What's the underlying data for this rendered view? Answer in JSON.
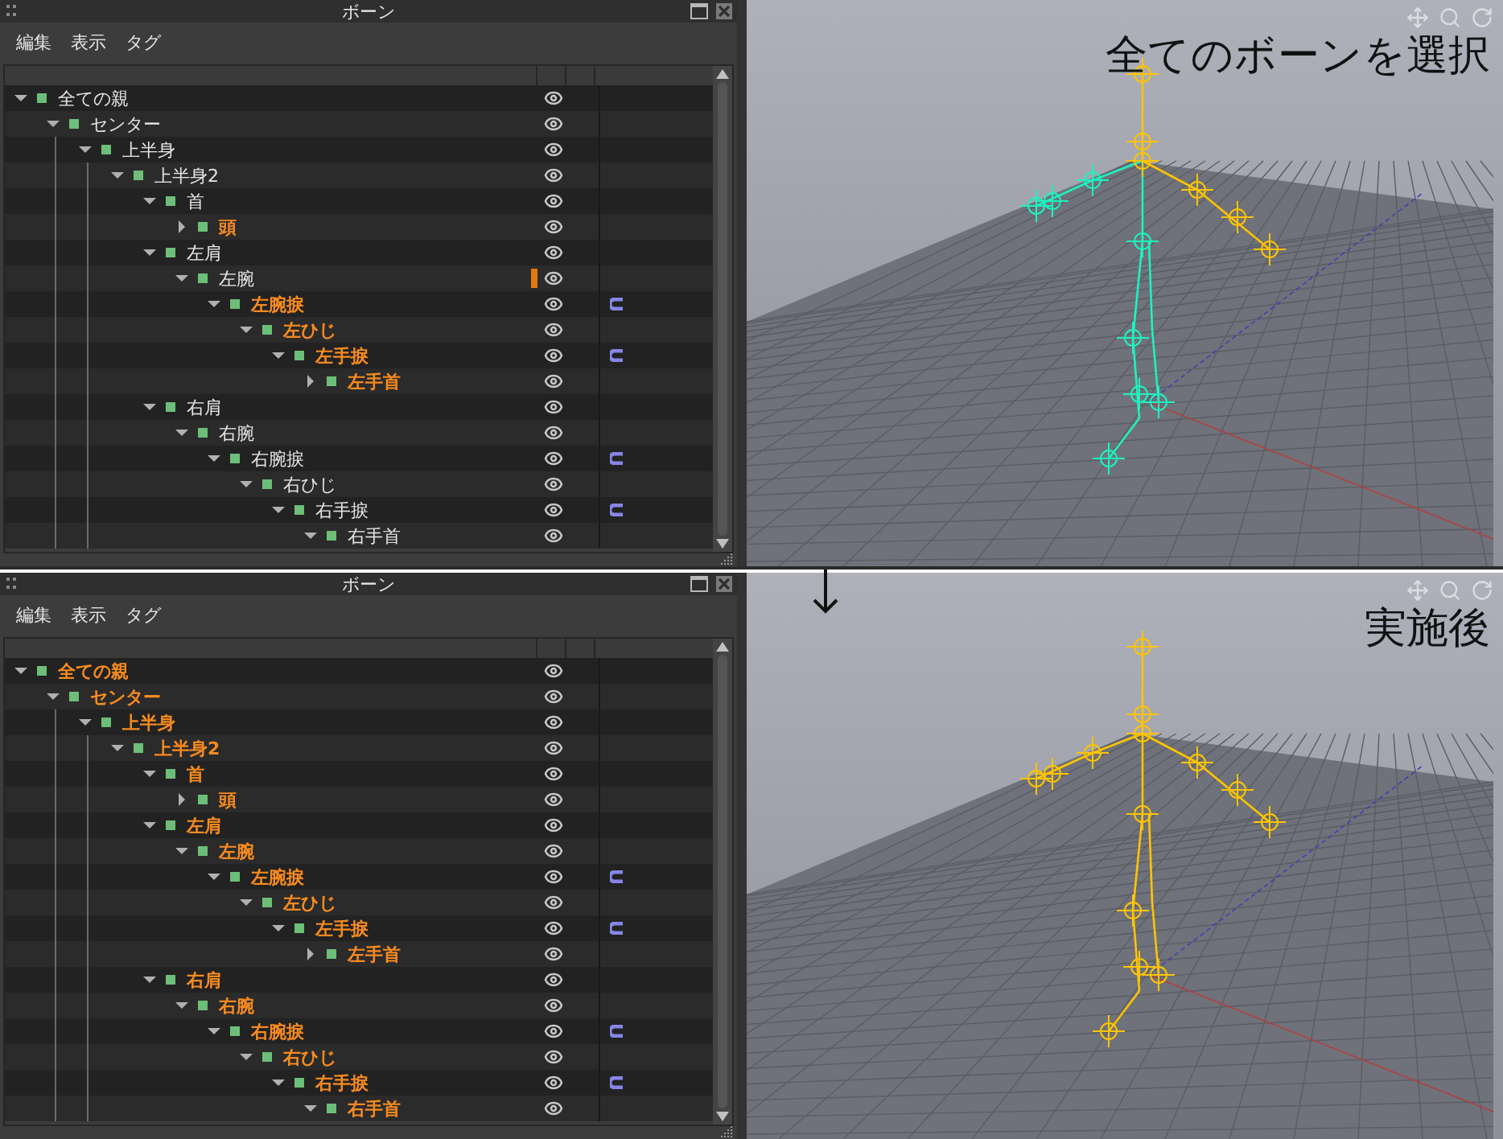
{
  "panels": [
    {
      "window": {
        "title": "ボーン"
      },
      "menu": [
        "編集",
        "表示",
        "タグ"
      ],
      "tree": [
        {
          "label": "全ての親",
          "selected": false,
          "expanded": true,
          "visible": true,
          "constraint": false,
          "marked": false,
          "children": [
            {
              "label": "センター",
              "selected": false,
              "expanded": true,
              "visible": true,
              "constraint": false,
              "marked": false,
              "children": [
                {
                  "label": "上半身",
                  "selected": false,
                  "expanded": true,
                  "visible": true,
                  "constraint": false,
                  "marked": false,
                  "children": [
                    {
                      "label": "上半身2",
                      "selected": false,
                      "expanded": true,
                      "visible": true,
                      "constraint": false,
                      "marked": false,
                      "children": [
                        {
                          "label": "首",
                          "selected": false,
                          "expanded": true,
                          "visible": true,
                          "constraint": false,
                          "marked": false,
                          "children": [
                            {
                              "label": "頭",
                              "selected": true,
                              "expanded": false,
                              "visible": true,
                              "constraint": false,
                              "marked": false
                            }
                          ]
                        },
                        {
                          "label": "左肩",
                          "selected": false,
                          "expanded": true,
                          "visible": true,
                          "constraint": false,
                          "marked": false,
                          "children": [
                            {
                              "label": "左腕",
                              "selected": false,
                              "expanded": true,
                              "visible": true,
                              "constraint": false,
                              "marked": true,
                              "children": [
                                {
                                  "label": "左腕捩",
                                  "selected": true,
                                  "expanded": true,
                                  "visible": true,
                                  "constraint": true,
                                  "marked": false,
                                  "children": [
                                    {
                                      "label": "左ひじ",
                                      "selected": true,
                                      "expanded": true,
                                      "visible": true,
                                      "constraint": false,
                                      "marked": false,
                                      "children": [
                                        {
                                          "label": "左手捩",
                                          "selected": true,
                                          "expanded": true,
                                          "visible": true,
                                          "constraint": true,
                                          "marked": false,
                                          "children": [
                                            {
                                              "label": "左手首",
                                              "selected": true,
                                              "expanded": false,
                                              "visible": true,
                                              "constraint": false,
                                              "marked": false
                                            }
                                          ]
                                        }
                                      ]
                                    }
                                  ]
                                }
                              ]
                            }
                          ]
                        },
                        {
                          "label": "右肩",
                          "selected": false,
                          "expanded": true,
                          "visible": true,
                          "constraint": false,
                          "marked": false,
                          "children": [
                            {
                              "label": "右腕",
                              "selected": false,
                              "expanded": true,
                              "visible": true,
                              "constraint": false,
                              "marked": false,
                              "children": [
                                {
                                  "label": "右腕捩",
                                  "selected": false,
                                  "expanded": true,
                                  "visible": true,
                                  "constraint": true,
                                  "marked": false,
                                  "children": [
                                    {
                                      "label": "右ひじ",
                                      "selected": false,
                                      "expanded": true,
                                      "visible": true,
                                      "constraint": false,
                                      "marked": false,
                                      "children": [
                                        {
                                          "label": "右手捩",
                                          "selected": false,
                                          "expanded": true,
                                          "visible": true,
                                          "constraint": true,
                                          "marked": false,
                                          "children": [
                                            {
                                              "label": "右手首",
                                              "selected": false,
                                              "expanded": true,
                                              "visible": true,
                                              "constraint": false,
                                              "marked": false
                                            }
                                          ]
                                        }
                                      ]
                                    }
                                  ]
                                }
                              ]
                            }
                          ]
                        }
                      ]
                    }
                  ]
                }
              ]
            }
          ]
        }
      ],
      "viewport": {
        "caption": "全てのボーンを選択",
        "all_selected": false,
        "arrow_below": false
      }
    },
    {
      "window": {
        "title": "ボーン"
      },
      "menu": [
        "編集",
        "表示",
        "タグ"
      ],
      "tree": [
        {
          "label": "全ての親",
          "selected": true,
          "expanded": true,
          "visible": true,
          "constraint": false,
          "marked": false,
          "children": [
            {
              "label": "センター",
              "selected": true,
              "expanded": true,
              "visible": true,
              "constraint": false,
              "marked": false,
              "children": [
                {
                  "label": "上半身",
                  "selected": true,
                  "expanded": true,
                  "visible": true,
                  "constraint": false,
                  "marked": false,
                  "children": [
                    {
                      "label": "上半身2",
                      "selected": true,
                      "expanded": true,
                      "visible": true,
                      "constraint": false,
                      "marked": false,
                      "children": [
                        {
                          "label": "首",
                          "selected": true,
                          "expanded": true,
                          "visible": true,
                          "constraint": false,
                          "marked": false,
                          "children": [
                            {
                              "label": "頭",
                              "selected": true,
                              "expanded": false,
                              "visible": true,
                              "constraint": false,
                              "marked": false
                            }
                          ]
                        },
                        {
                          "label": "左肩",
                          "selected": true,
                          "expanded": true,
                          "visible": true,
                          "constraint": false,
                          "marked": false,
                          "children": [
                            {
                              "label": "左腕",
                              "selected": true,
                              "expanded": true,
                              "visible": true,
                              "constraint": false,
                              "marked": false,
                              "children": [
                                {
                                  "label": "左腕捩",
                                  "selected": true,
                                  "expanded": true,
                                  "visible": true,
                                  "constraint": true,
                                  "marked": false,
                                  "children": [
                                    {
                                      "label": "左ひじ",
                                      "selected": true,
                                      "expanded": true,
                                      "visible": true,
                                      "constraint": false,
                                      "marked": false,
                                      "children": [
                                        {
                                          "label": "左手捩",
                                          "selected": true,
                                          "expanded": true,
                                          "visible": true,
                                          "constraint": true,
                                          "marked": false,
                                          "children": [
                                            {
                                              "label": "左手首",
                                              "selected": true,
                                              "expanded": false,
                                              "visible": true,
                                              "constraint": false,
                                              "marked": false
                                            }
                                          ]
                                        }
                                      ]
                                    }
                                  ]
                                }
                              ]
                            }
                          ]
                        },
                        {
                          "label": "右肩",
                          "selected": true,
                          "expanded": true,
                          "visible": true,
                          "constraint": false,
                          "marked": false,
                          "children": [
                            {
                              "label": "右腕",
                              "selected": true,
                              "expanded": true,
                              "visible": true,
                              "constraint": false,
                              "marked": false,
                              "children": [
                                {
                                  "label": "右腕捩",
                                  "selected": true,
                                  "expanded": true,
                                  "visible": true,
                                  "constraint": true,
                                  "marked": false,
                                  "children": [
                                    {
                                      "label": "右ひじ",
                                      "selected": true,
                                      "expanded": true,
                                      "visible": true,
                                      "constraint": false,
                                      "marked": false,
                                      "children": [
                                        {
                                          "label": "右手捩",
                                          "selected": true,
                                          "expanded": true,
                                          "visible": true,
                                          "constraint": true,
                                          "marked": false,
                                          "children": [
                                            {
                                              "label": "右手首",
                                              "selected": true,
                                              "expanded": true,
                                              "visible": true,
                                              "constraint": false,
                                              "marked": false
                                            }
                                          ]
                                        }
                                      ]
                                    }
                                  ]
                                }
                              ]
                            }
                          ]
                        }
                      ]
                    }
                  ]
                }
              ]
            }
          ]
        }
      ],
      "viewport": {
        "caption": "実施後",
        "all_selected": true,
        "arrow_below": true
      }
    }
  ]
}
